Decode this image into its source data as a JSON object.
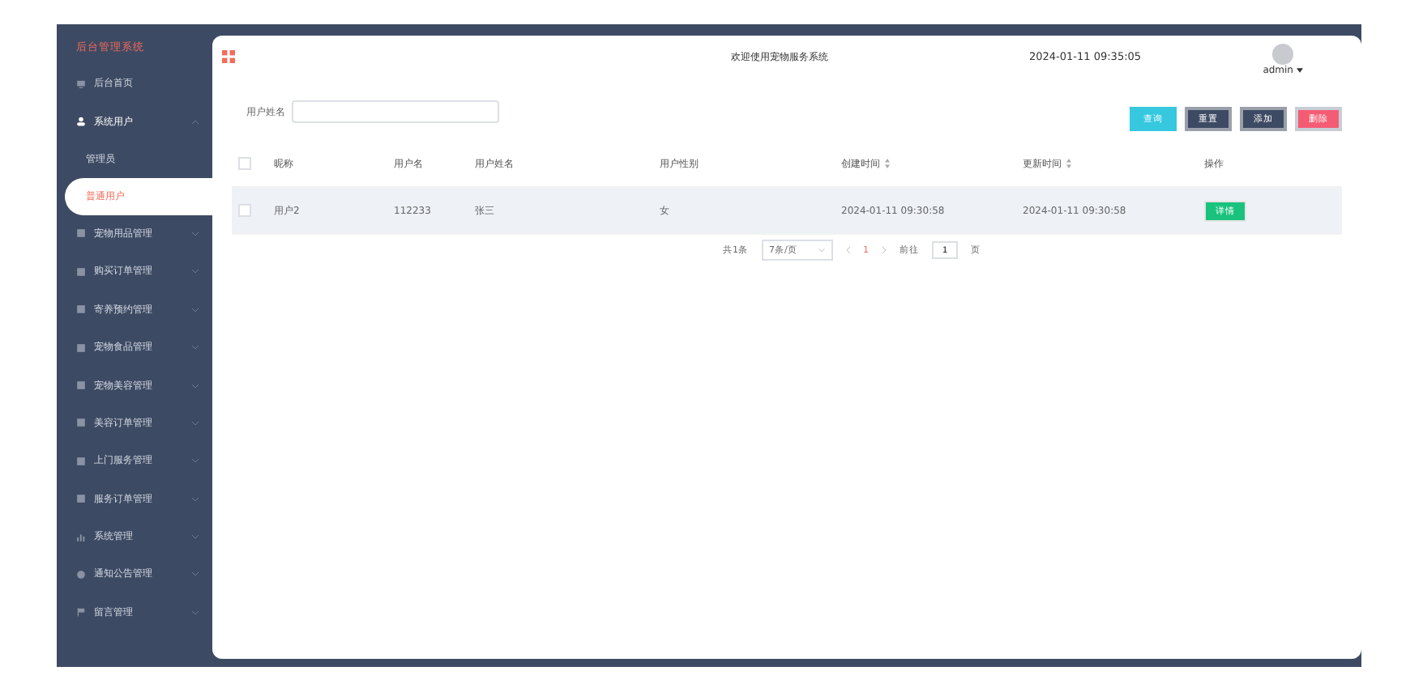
{
  "sidebar": {
    "title": "后台管理系统",
    "items": [
      {
        "label": "后台首页"
      },
      {
        "label": "系统用户",
        "expanded": true,
        "children": [
          {
            "label": "管理员",
            "selected": false
          },
          {
            "label": "普通用户",
            "selected": true
          }
        ]
      },
      {
        "label": "宠物用品管理",
        "expanded": false
      },
      {
        "label": "购买订单管理",
        "expanded": false
      },
      {
        "label": "寄养预约管理",
        "expanded": false
      },
      {
        "label": "宠物食品管理",
        "expanded": false
      },
      {
        "label": "宠物美容管理",
        "expanded": false
      },
      {
        "label": "美容订单管理",
        "expanded": false
      },
      {
        "label": "上门服务管理",
        "expanded": false
      },
      {
        "label": "服务订单管理",
        "expanded": false
      },
      {
        "label": "系统管理",
        "expanded": false
      },
      {
        "label": "通知公告管理",
        "expanded": false
      },
      {
        "label": "留言管理",
        "expanded": false
      }
    ]
  },
  "header": {
    "welcome": "欢迎使用宠物服务系统",
    "datetime": "2024-01-11 09:35:05",
    "user": "admin"
  },
  "search": {
    "label": "用户姓名"
  },
  "buttons": [
    {
      "label": "查询",
      "kind": "query"
    },
    {
      "label": "重置",
      "kind": "dark"
    },
    {
      "label": "添加",
      "kind": "dark"
    },
    {
      "label": "删除",
      "kind": "danger"
    }
  ],
  "table": {
    "all_checked": false,
    "columns": [
      {
        "label": "昵称",
        "sortable": false
      },
      {
        "label": "用户名",
        "sortable": false
      },
      {
        "label": "用户姓名",
        "sortable": false
      },
      {
        "label": "用户性别",
        "sortable": false
      },
      {
        "label": "创建时间",
        "sortable": true
      },
      {
        "label": "更新时间",
        "sortable": true
      },
      {
        "label": "操作",
        "sortable": false
      }
    ],
    "rows": [
      {
        "checked": false,
        "cells": [
          "用户2",
          "112233",
          "张三",
          "女",
          "2024-01-11 09:30:58",
          "2024-01-11 09:30:58"
        ],
        "action": "详情"
      }
    ]
  },
  "pagination": {
    "total": "共1条",
    "page_size": "7条/页",
    "pages": [
      {
        "label": "1",
        "selected": true
      }
    ],
    "goto_label": "前往",
    "goto_value": "1",
    "goto_suffix": "页"
  }
}
